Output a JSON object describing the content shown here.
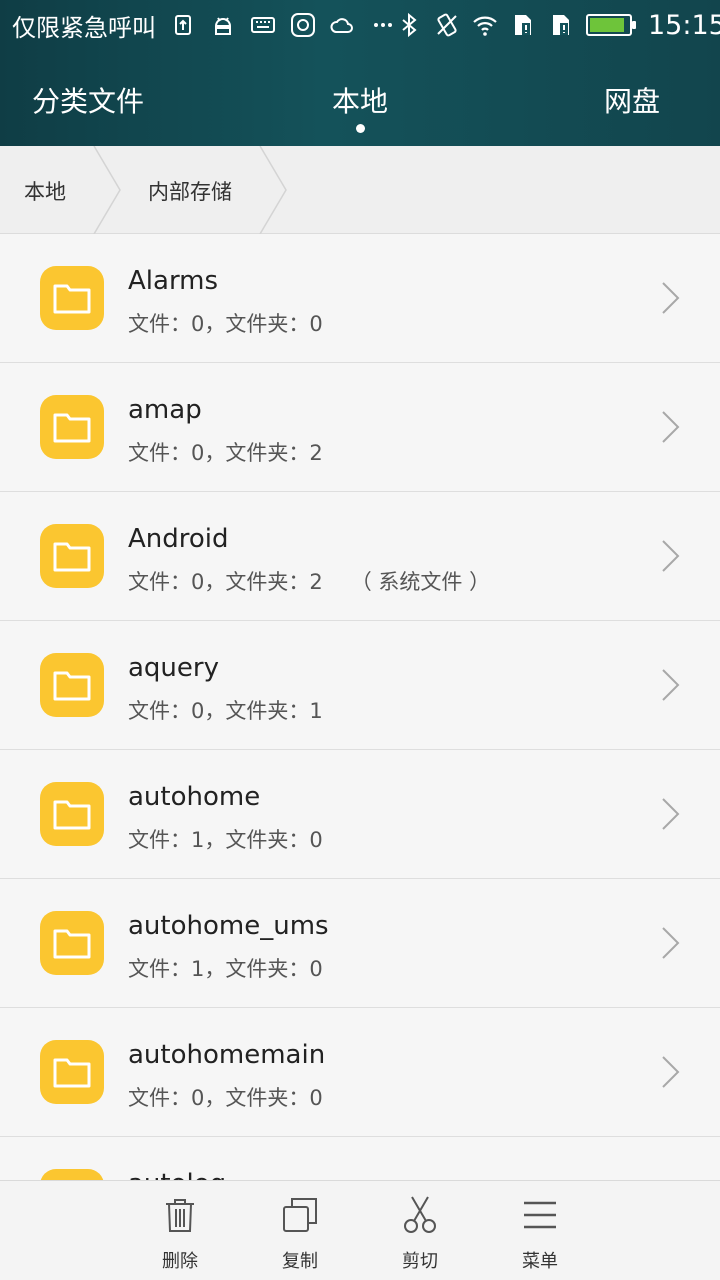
{
  "status_bar": {
    "carrier_text": "仅限紧急呼叫",
    "time": "15:15",
    "icons": [
      "upload-notify-icon",
      "android-icon",
      "keyboard-icon",
      "huawei-icon",
      "weather-icon",
      "more-dots-icon",
      "bluetooth-icon",
      "vibrate-icon",
      "wifi-icon",
      "sim1-icon",
      "sim2-icon",
      "battery-icon"
    ],
    "battery_level": 0.9,
    "battery_color": "#6ec43a"
  },
  "tabs": [
    {
      "label": "分类文件"
    },
    {
      "label": "本地"
    },
    {
      "label": "网盘"
    }
  ],
  "breadcrumb": [
    "本地",
    "内部存储"
  ],
  "files": [
    {
      "name": "Alarms",
      "meta": "文件：0，文件夹：0",
      "note": ""
    },
    {
      "name": "amap",
      "meta": "文件：0，文件夹：2",
      "note": ""
    },
    {
      "name": "Android",
      "meta": "文件：0，文件夹：2",
      "note": "（ 系统文件 ）"
    },
    {
      "name": "aquery",
      "meta": "文件：0，文件夹：1",
      "note": ""
    },
    {
      "name": "autohome",
      "meta": "文件：1，文件夹：0",
      "note": ""
    },
    {
      "name": "autohome_ums",
      "meta": "文件：1，文件夹：0",
      "note": ""
    },
    {
      "name": "autohomemain",
      "meta": "文件：0，文件夹：0",
      "note": ""
    },
    {
      "name": "autolog",
      "meta": "",
      "note": ""
    }
  ],
  "bottom_bar": [
    {
      "label": "删除",
      "icon": "trash-icon"
    },
    {
      "label": "复制",
      "icon": "copy-icon"
    },
    {
      "label": "剪切",
      "icon": "scissors-icon"
    },
    {
      "label": "菜单",
      "icon": "menu-icon"
    }
  ],
  "colors": {
    "header": "#14525a",
    "folder": "#fbc630"
  }
}
